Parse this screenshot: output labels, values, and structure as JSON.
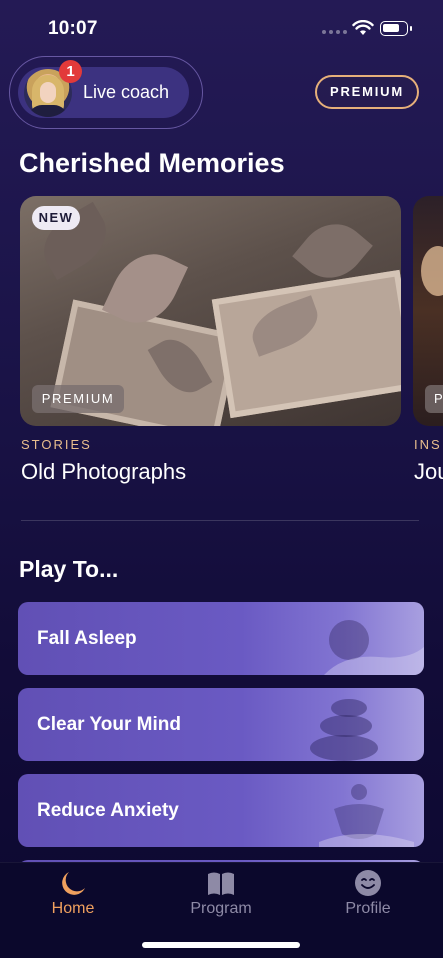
{
  "status_bar": {
    "time": "10:07"
  },
  "header": {
    "coach_label": "Live coach",
    "coach_badge": "1",
    "premium_button": "PREMIUM"
  },
  "memories": {
    "title": "Cherished Memories",
    "cards": [
      {
        "tag_new": "NEW",
        "tag_premium": "PREMIUM",
        "category": "STORIES",
        "title": "Old Photographs"
      },
      {
        "tag_premium": "P",
        "category": "INS",
        "title": "Jou"
      }
    ]
  },
  "play": {
    "title": "Play To...",
    "items": [
      {
        "label": "Fall Asleep"
      },
      {
        "label": "Clear Your Mind"
      },
      {
        "label": "Reduce Anxiety"
      }
    ]
  },
  "tabs": [
    {
      "label": "Home",
      "icon": "moon-icon",
      "active": true
    },
    {
      "label": "Program",
      "icon": "book-icon",
      "active": false
    },
    {
      "label": "Profile",
      "icon": "smiley-face-icon",
      "active": false
    }
  ],
  "colors": {
    "accent": "#f0a05e",
    "badge": "#e23a3a",
    "premium_border": "#e6b07a",
    "play_item": "#6150b5"
  }
}
